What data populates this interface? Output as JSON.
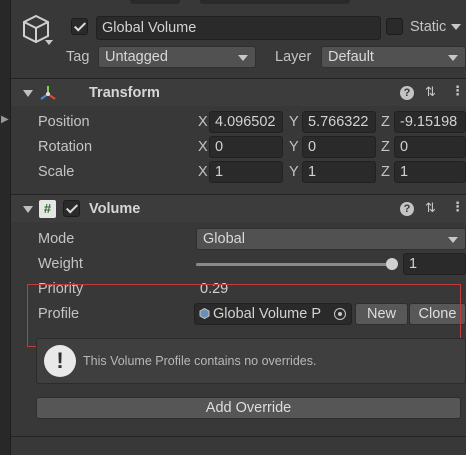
{
  "gameobject": {
    "name": "Global Volume",
    "active": true,
    "static_label": "Static",
    "tag_label": "Tag",
    "tag_value": "Untagged",
    "layer_label": "Layer",
    "layer_value": "Default"
  },
  "transform": {
    "title": "Transform",
    "position_label": "Position",
    "rotation_label": "Rotation",
    "scale_label": "Scale",
    "x": "X",
    "y": "Y",
    "z": "Z",
    "position": {
      "x": "4.096502",
      "y": "5.766322",
      "z": "-9.15198"
    },
    "rotation": {
      "x": "0",
      "y": "0",
      "z": "0"
    },
    "scale": {
      "x": "1",
      "y": "1",
      "z": "1"
    }
  },
  "volume": {
    "title": "Volume",
    "enabled": true,
    "mode_label": "Mode",
    "mode_value": "Global",
    "weight_label": "Weight",
    "weight_value": "1",
    "weight_fraction": 1.0,
    "priority_label": "Priority",
    "priority_value": "0.29",
    "profile_label": "Profile",
    "profile_value": "Global Volume P",
    "new_button": "New",
    "clone_button": "Clone",
    "help_message": "This Volume Profile contains no overrides.",
    "add_override_button": "Add Override"
  },
  "icons": {
    "gameobject": "cube-icon",
    "transform": "transform-axes-icon",
    "volume": "script-icon",
    "help": "help-icon",
    "presets": "presets-icon",
    "menu": "kebab-menu-icon"
  },
  "colors": {
    "background": "#383838",
    "field": "#2a2a2a",
    "highlight_box": "#c53b3b",
    "warning": "#e9e9e9"
  }
}
